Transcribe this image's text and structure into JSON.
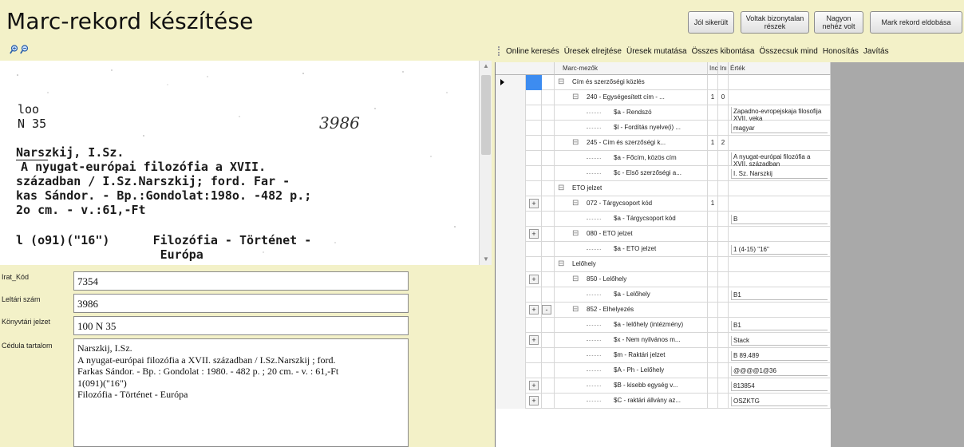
{
  "header": {
    "title": "Marc-rekord készítése",
    "buttons": [
      {
        "label": "Jól sikerült"
      },
      {
        "label": "Voltak bizonytalan részek"
      },
      {
        "label": "Nagyon nehéz volt"
      },
      {
        "label": "Mark rekord eldobása"
      }
    ]
  },
  "icons": [
    "zoom-in-icon",
    "zoom-out-icon"
  ],
  "card": {
    "call_no_line1": "loo",
    "call_no_line2": "N 35",
    "inventory_hand": "3986",
    "author": "Narszkij, I.Sz.",
    "line1": "  A nyugat-európai filozófia a XVII.",
    "line2": "században / I.Sz.Narszkij; ford. Far -",
    "line3": "kas Sándor. - Bp.:Gondolat:198o. -482 p.;",
    "line4": "2o cm. - v.:61,-Ft",
    "line5": "l (o91)(\"16\")      Filozófia - Történet -",
    "line6": "                    Európa"
  },
  "form": {
    "irat_kod": {
      "label": "Irat_Kód",
      "value": "7354"
    },
    "leltari_szam": {
      "label": "Leltári szám",
      "value": "3986"
    },
    "konyvtari_jelzet": {
      "label": "Könyvtári jelzet",
      "value": "100 N 35"
    },
    "cedula": {
      "label": "Cédula tartalom",
      "lines": [
        "Narszkij, I.Sz.",
        "A nyugat-európai filozófia a XVII. században / I.Sz.Narszkij ; ford.",
        "Farkas Sándor. - Bp. : Gondolat : 1980. - 482 p. ; 20 cm. - v. : 61,-Ft",
        "1(091)(\"16\")",
        "Filozófia - Történet - Európa"
      ]
    }
  },
  "toolbar": {
    "items": [
      "Online keresés",
      "Üresek elrejtése",
      "Üresek mutatása",
      "Összes kibontása",
      "Összecsuk mind",
      "Honosítás",
      "Javítás"
    ]
  },
  "grid": {
    "headers": {
      "name": "Marc-mezők",
      "ind1": "Inc",
      "ind2": "Inı",
      "value": "Érték"
    },
    "rows": [
      {
        "level": 0,
        "name": "Cím és szerzőségi közlés",
        "i1": "",
        "i2": "",
        "value": "",
        "box": false,
        "btn": "",
        "selected": true
      },
      {
        "level": 1,
        "name": "240 - Egységesített cím - ...",
        "i1": "1",
        "i2": "0",
        "value": "",
        "box": false,
        "btn": ""
      },
      {
        "level": 2,
        "name": "$a - Rendszó",
        "i1": "",
        "i2": "",
        "value": "Zapadno-evropejskaja filosofija XVII. veka",
        "box": true,
        "btn": ""
      },
      {
        "level": 2,
        "name": "$l - Fordítás nyelve(i) ...",
        "i1": "",
        "i2": "",
        "value": "magyar",
        "box": true,
        "btn": ""
      },
      {
        "level": 1,
        "name": "245 - Cím és szerzőségi k...",
        "i1": "1",
        "i2": "2",
        "value": "",
        "box": false,
        "btn": ""
      },
      {
        "level": 2,
        "name": "$a - Főcím, közös cím",
        "i1": "",
        "i2": "",
        "value": "A nyugat-európai filozófia a XVII. században",
        "box": true,
        "btn": ""
      },
      {
        "level": 2,
        "name": "$c - Első szerzőségi a...",
        "i1": "",
        "i2": "",
        "value": "I. Sz. Narszkij",
        "box": true,
        "btn": ""
      },
      {
        "level": 0,
        "name": "ETO jelzet",
        "i1": "",
        "i2": "",
        "value": "",
        "box": false,
        "btn": ""
      },
      {
        "level": 1,
        "name": "072 - Tárgycsoport kód",
        "i1": "1",
        "i2": "",
        "value": "",
        "box": false,
        "btn": "+"
      },
      {
        "level": 2,
        "name": "$a - Tárgycsoport kód",
        "i1": "",
        "i2": "",
        "value": "B",
        "box": true,
        "btn": ""
      },
      {
        "level": 1,
        "name": "080 - ETO jelzet",
        "i1": "",
        "i2": "",
        "value": "",
        "box": false,
        "btn": "+"
      },
      {
        "level": 2,
        "name": "$a - ETO jelzet",
        "i1": "",
        "i2": "",
        "value": "1 (4-15) \"16\"",
        "box": true,
        "btn": ""
      },
      {
        "level": 0,
        "name": "Lelőhely",
        "i1": "",
        "i2": "",
        "value": "",
        "box": false,
        "btn": ""
      },
      {
        "level": 1,
        "name": "850 - Lelőhely",
        "i1": "",
        "i2": "",
        "value": "",
        "box": false,
        "btn": "+"
      },
      {
        "level": 2,
        "name": "$a - Lelőhely",
        "i1": "",
        "i2": "",
        "value": "B1",
        "box": true,
        "btn": ""
      },
      {
        "level": 1,
        "name": "852 - Elhelyezés",
        "i1": "",
        "i2": "",
        "value": "",
        "box": false,
        "btn": "+-"
      },
      {
        "level": 2,
        "name": "$a - lelőhely (intézmény)",
        "i1": "",
        "i2": "",
        "value": "B1",
        "box": true,
        "btn": ""
      },
      {
        "level": 2,
        "name": "$x - Nem nyilvános m...",
        "i1": "",
        "i2": "",
        "value": "Stack",
        "box": true,
        "btn": "+"
      },
      {
        "level": 2,
        "name": "$m - Raktári jelzet",
        "i1": "",
        "i2": "",
        "value": "B 89.489",
        "box": true,
        "btn": ""
      },
      {
        "level": 2,
        "name": "$A - Ph - Lelőhely",
        "i1": "",
        "i2": "",
        "value": "@@@@1@36",
        "box": true,
        "btn": ""
      },
      {
        "level": 2,
        "name": "$B - kisebb egység v...",
        "i1": "",
        "i2": "",
        "value": "813854",
        "box": true,
        "btn": "+"
      },
      {
        "level": 2,
        "name": "$C - raktári állvány az...",
        "i1": "",
        "i2": "",
        "value": "OSZKTG",
        "box": true,
        "btn": "+"
      }
    ]
  },
  "colors": {
    "background": "#f3f1c8",
    "selection": "#3d8cf0",
    "grid_bg": "#a9a9a9"
  }
}
